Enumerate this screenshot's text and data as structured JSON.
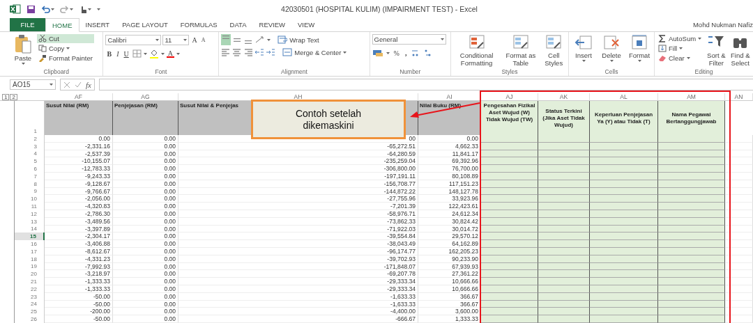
{
  "window": {
    "title": "42030501 (HOSPITAL KULIM) (IMPAIRMENT TEST) - Excel",
    "user": "Mohd Nukman Nafiz"
  },
  "tabs": [
    {
      "label": "FILE",
      "kind": "file",
      "selected": false
    },
    {
      "label": "HOME",
      "kind": "tab",
      "selected": true
    },
    {
      "label": "INSERT",
      "kind": "tab",
      "selected": false
    },
    {
      "label": "PAGE LAYOUT",
      "kind": "tab",
      "selected": false
    },
    {
      "label": "FORMULAS",
      "kind": "tab",
      "selected": false
    },
    {
      "label": "DATA",
      "kind": "tab",
      "selected": false
    },
    {
      "label": "REVIEW",
      "kind": "tab",
      "selected": false
    },
    {
      "label": "VIEW",
      "kind": "tab",
      "selected": false
    }
  ],
  "ribbon": {
    "clipboard": {
      "label": "Clipboard",
      "paste": "Paste",
      "cut": "Cut",
      "copy": "Copy",
      "format_painter": "Format Painter"
    },
    "font": {
      "label": "Font",
      "name": "Calibri",
      "size": "11",
      "grow": "A",
      "shrink": "A",
      "bold": "B",
      "italic": "I",
      "underline": "U",
      "text_color_button": "A"
    },
    "alignment": {
      "label": "Alignment",
      "vertical": [
        {
          "selected": true
        },
        {
          "selected": false
        },
        {
          "selected": false
        }
      ],
      "wrap_text": "Wrap Text",
      "merge": "Merge & Center"
    },
    "number": {
      "label": "Number",
      "format": "General",
      "percent": "%",
      "comma": ","
    },
    "styles": {
      "label": "Styles",
      "buttons": [
        "Conditional Formatting",
        "Format as Table",
        "Cell Styles"
      ]
    },
    "cells": {
      "label": "Cells",
      "buttons": [
        "Insert",
        "Delete",
        "Format"
      ]
    },
    "editing": {
      "label": "Editing",
      "small": [
        "AutoSum",
        "Fill",
        "Clear"
      ],
      "large": [
        "Sort & Filter",
        "Find & Select"
      ]
    }
  },
  "formula_bar": {
    "name_box": "AO15",
    "fx": "fx"
  },
  "sheet": {
    "outline_levels": [
      "1",
      "2"
    ],
    "columns": [
      {
        "letter": "AF",
        "highlighted": false
      },
      {
        "letter": "AG",
        "highlighted": false
      },
      {
        "letter": "AH",
        "highlighted": false
      },
      {
        "letter": "AI",
        "highlighted": false
      },
      {
        "letter": "AJ",
        "highlighted": true
      },
      {
        "letter": "AK",
        "highlighted": true
      },
      {
        "letter": "AL",
        "highlighted": true
      },
      {
        "letter": "AM",
        "highlighted": true
      },
      {
        "letter": "AN",
        "highlighted": false
      }
    ],
    "header_row": "1",
    "headers": [
      "Susut Nilai (RM)",
      "Penjejasan (RM)",
      "Susut Nilai & Penjejas",
      "Nilai Buku (RM)",
      "Pengesahan Fizikal Aset Wujud (W) Tidak Wujud (TW)",
      "Status Terkini (Jika Aset Tidak Wujud)",
      "Keperluan Penjejasan Ya (Y) atau Tidak (T)",
      "Nama Pegawai Bertanggungjawab"
    ],
    "rows": [
      {
        "row": "2",
        "selected": false,
        "cells": [
          "0.00",
          "0.00",
          "00",
          "0.00"
        ]
      },
      {
        "row": "3",
        "selected": false,
        "cells": [
          "-2,331.16",
          "0.00",
          "-65,272.51",
          "4,662.33"
        ]
      },
      {
        "row": "4",
        "selected": false,
        "cells": [
          "-2,537.39",
          "0.00",
          "-64,280.59",
          "11,841.17"
        ]
      },
      {
        "row": "5",
        "selected": false,
        "cells": [
          "-10,155.07",
          "0.00",
          "-235,259.04",
          "69,392.96"
        ]
      },
      {
        "row": "6",
        "selected": false,
        "cells": [
          "-12,783.33",
          "0.00",
          "-306,800.00",
          "76,700.00"
        ]
      },
      {
        "row": "7",
        "selected": false,
        "cells": [
          "-9,243.33",
          "0.00",
          "-197,191.11",
          "80,108.89"
        ]
      },
      {
        "row": "8",
        "selected": false,
        "cells": [
          "-9,128.67",
          "0.00",
          "-156,708.77",
          "117,151.23"
        ]
      },
      {
        "row": "9",
        "selected": false,
        "cells": [
          "-9,766.67",
          "0.00",
          "-144,872.22",
          "148,127.78"
        ]
      },
      {
        "row": "10",
        "selected": false,
        "cells": [
          "-2,056.00",
          "0.00",
          "-27,755.96",
          "33,923.96"
        ]
      },
      {
        "row": "11",
        "selected": false,
        "cells": [
          "-4,320.83",
          "0.00",
          "-7,201.39",
          "122,423.61"
        ]
      },
      {
        "row": "12",
        "selected": false,
        "cells": [
          "-2,786.30",
          "0.00",
          "-58,976.71",
          "24,612.34"
        ]
      },
      {
        "row": "13",
        "selected": false,
        "cells": [
          "-3,489.56",
          "0.00",
          "-73,862.33",
          "30,824.42"
        ]
      },
      {
        "row": "14",
        "selected": false,
        "cells": [
          "-3,397.89",
          "0.00",
          "-71,922.03",
          "30,014.72"
        ]
      },
      {
        "row": "15",
        "selected": true,
        "cells": [
          "-2,304.17",
          "0.00",
          "-39,554.84",
          "29,570.12"
        ]
      },
      {
        "row": "16",
        "selected": false,
        "cells": [
          "-3,406.88",
          "0.00",
          "-38,043.49",
          "64,162.89"
        ]
      },
      {
        "row": "17",
        "selected": false,
        "cells": [
          "-8,612.67",
          "0.00",
          "-96,174.77",
          "162,205.23"
        ]
      },
      {
        "row": "18",
        "selected": false,
        "cells": [
          "-4,331.23",
          "0.00",
          "-39,702.93",
          "90,233.90"
        ]
      },
      {
        "row": "19",
        "selected": false,
        "cells": [
          "-7,992.93",
          "0.00",
          "-171,848.07",
          "67,939.93"
        ]
      },
      {
        "row": "20",
        "selected": false,
        "cells": [
          "-3,218.97",
          "0.00",
          "-69,207.78",
          "27,361.22"
        ]
      },
      {
        "row": "21",
        "selected": false,
        "cells": [
          "-1,333.33",
          "0.00",
          "-29,333.34",
          "10,666.66"
        ]
      },
      {
        "row": "22",
        "selected": false,
        "cells": [
          "-1,333.33",
          "0.00",
          "-29,333.34",
          "10,666.66"
        ]
      },
      {
        "row": "23",
        "selected": false,
        "cells": [
          "-50.00",
          "0.00",
          "-1,633.33",
          "366.67"
        ]
      },
      {
        "row": "24",
        "selected": false,
        "cells": [
          "-50.00",
          "0.00",
          "-1,633.33",
          "366.67"
        ]
      },
      {
        "row": "25",
        "selected": false,
        "cells": [
          "-200.00",
          "0.00",
          "-4,400.00",
          "3,600.00"
        ]
      },
      {
        "row": "26",
        "selected": false,
        "cells": [
          "-50.00",
          "0.00",
          "-666.67",
          "1,333.33"
        ]
      }
    ]
  },
  "callout": {
    "text": "Contoh setelah dikemaskini"
  }
}
